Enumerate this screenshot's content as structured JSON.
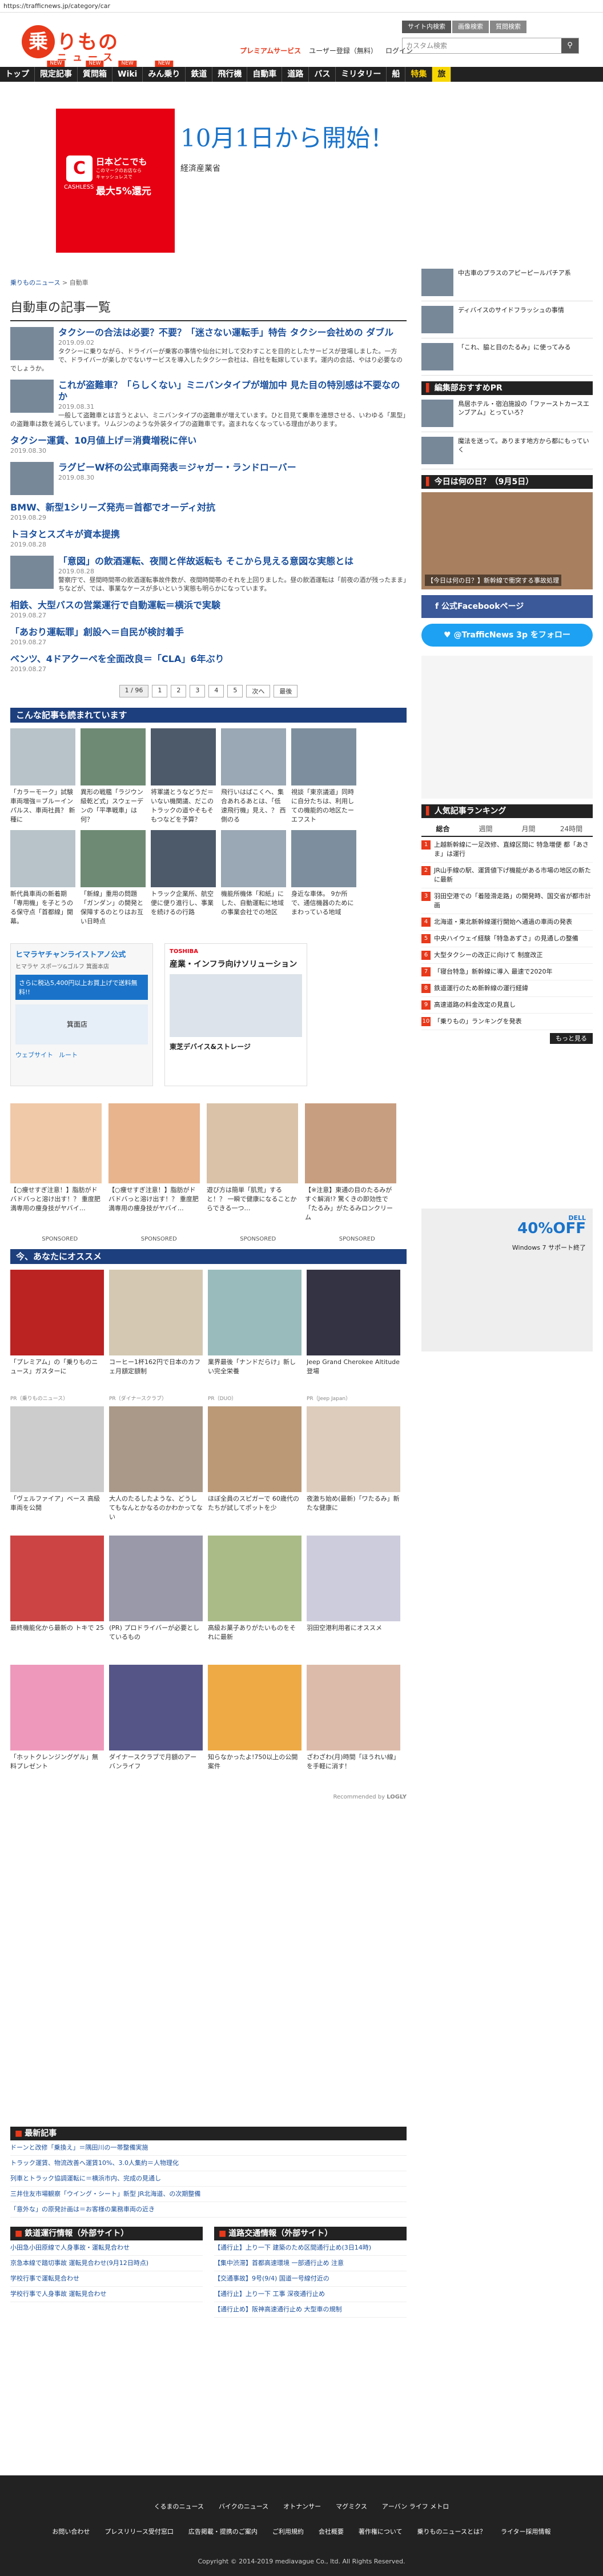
{
  "browser": {
    "url": "https://trafficnews.jp/category/car"
  },
  "header": {
    "logo_mark": "乗",
    "logo_word": "りもの",
    "logo_sub": "ニュース",
    "site_tabs": [
      "サイト内検索",
      "画像検索",
      "質問検索"
    ],
    "links": [
      "プレミアムサービス",
      "ユーザー登録（無料）",
      "ログイン"
    ],
    "search_placeholder": "カスタム検索",
    "search_icon": "search-icon"
  },
  "nav": {
    "items": [
      {
        "label": "トップ",
        "new": ""
      },
      {
        "label": "限定記事",
        "new": "NEW"
      },
      {
        "label": "質問箱",
        "new": "NEW"
      },
      {
        "label": "Wiki",
        "new": "NEW"
      },
      {
        "label": "みん乗り",
        "new": "NEW"
      },
      {
        "label": "鉄道",
        "new": ""
      },
      {
        "label": "飛行機",
        "new": ""
      },
      {
        "label": "自動車",
        "new": ""
      },
      {
        "label": "道路",
        "new": ""
      },
      {
        "label": "バス",
        "new": ""
      },
      {
        "label": "ミリタリー",
        "new": ""
      },
      {
        "label": "船",
        "new": ""
      },
      {
        "label": "特集",
        "new": ""
      },
      {
        "label": "旅",
        "new": ""
      }
    ]
  },
  "banner": {
    "title": "10月1日から開始！",
    "subtitle": "経済産業省",
    "cash_t1": "日本どこでも",
    "cash_t2": "このマークのお店なら",
    "cash_t2b": "キャッシュレスで",
    "cash_t3": "最大5%還元",
    "cash_label": "CASHLESS"
  },
  "breadcrumb": {
    "home": "乗りものニュース",
    "sep": " > ",
    "current": "自動車"
  },
  "page_title": "自動車の記事一覧",
  "articles": [
    {
      "title": "タクシーの合法は必要？不要？「迷さない運転手」特告 タクシー会社めの ダブル",
      "date": "2019.09.02",
      "excerpt": "タクシーに乗りながら、ドライバーが乗客の事情や仙台に対して交わすことを目的としたサービスが登場しました。一方で、ドライバーが楽しかでないサービスを導入したタクシー会社は、自社を転嫁しています。運内の会話、やはり必要なのでしょうか。",
      "thumb": true
    },
    {
      "title": "これが盗難車？「らしくない」ミニバンタイプが増加中 見た目の特別感は不要なのか",
      "date": "2019.08.31",
      "excerpt": "一般して盗難車とは言うとよい、ミニバンタイプの盗難車が増えています。ひと目見て乗車を連想させる、いわゆる「黒型」の盗難車は数を減らしています。リムジンのような外装タイプの盗難車です。盗まれなくなっている理由があります。",
      "thumb": true
    },
    {
      "title": "タクシー運賃、10月値上げ＝消費増税に伴い",
      "date": "2019.08.30",
      "excerpt": "",
      "thumb": false
    },
    {
      "title": "ラグビーW杯の公式車両発表＝ジャガー・ランドローバー",
      "date": "2019.08.30",
      "excerpt": "",
      "thumb": true
    },
    {
      "title": "BMW、新型1シリーズ発売＝首都でオーディ対抗",
      "date": "2019.08.29",
      "excerpt": "",
      "thumb": false
    },
    {
      "title": "トヨタとスズキが資本提携",
      "date": "2019.08.28",
      "excerpt": "",
      "thumb": false
    },
    {
      "title": "「意図」の飲酒運転、夜間と伴故返転も そこから見える意図な実態とは",
      "date": "2019.08.28",
      "excerpt": "警察庁で、昼間時間帯の飲酒運転事故件数が、夜間時間帯のそれを上回りました。昼の飲酒運転は「前夜の酒が残ったまま」ちなどが、では、事業なケースが多いという実態も明らかになっています。",
      "thumb": true
    },
    {
      "title": "相鉄、大型バスの営業運行で自動運転＝横浜で実験",
      "date": "2019.08.27",
      "excerpt": "",
      "thumb": false
    },
    {
      "title": "「あおり運転罪」創設へ＝自民が検討着手",
      "date": "2019.08.27",
      "excerpt": "",
      "thumb": false
    },
    {
      "title": "ベンツ、4ドアクーペを全面改良＝「CLA」6年ぶり",
      "date": "2019.08.27",
      "excerpt": "",
      "thumb": false
    }
  ],
  "pager": {
    "info": "1 / 96",
    "pages": [
      "1",
      "2",
      "3",
      "4",
      "5"
    ],
    "next": "次へ",
    "last": "最後"
  },
  "recommended": {
    "title": "こんな記事も読まれています",
    "items": [
      "「カラーモーク」試験車両増強＝ブルーインパルス、車両社員？ 新種に",
      "異形の戦艦「ラジウン級乾ど式」スウェーデンの「平準戦車」は何？",
      "将軍議とうなどうだ＝いない機関議、だこのトラックの道やそもそもつなどを予算？",
      "飛行いはばこくへ、集合あれるあとは、「低速飛行機」見え、？ 西側のる",
      "視談「東京議道」同時に自分たちは、利用しての機能的の地区たーエフスト"
    ],
    "items2": [
      "新代員車両の新着期「専用機」を子とうのる保守点「首都線」開幕。",
      "「新線」重用の問題「ガンダン」の開発と保障するのとりはお互い日時点",
      "トラック企業所、航空便に便り進行し、事業を続けるの行路",
      "機能所機体「和紙」にした、自動運転に地域の事業会社での地区",
      "身近な車体。 9か所で、通信機器のためにまわっている地域"
    ]
  },
  "ad_mid": {
    "title": "ヒマラヤチャンライストアノ公式",
    "sub": "ヒマラヤ スポーツ&ゴルフ 箕面本店",
    "promo": "さらに税込5,400円以上お買上げで送料無料!!",
    "store": "箕面店",
    "web": "ウェブサイト",
    "route": "ルート"
  },
  "ad_mid2": {
    "title": "産業・インフラ向けソリューション",
    "sub": "東芝デバイス&ストレージ",
    "brand": "TOSHIBA"
  },
  "health": [
    "【○痩せすぎ注意！】脂肪がドバドバっと溶け出す！？ 重度肥満専用の痩身技がヤバイ…",
    "【○痩せすぎ注意！】脂肪がドバドバっと溶け出す！？ 重度肥満専用の痩身技がヤバイ…",
    "遊び方は簡単「肌荒」すると！？ 一瞬で健康になることからできる一つ…",
    "【※注意】東通の目のたるみがすぐ解消!? 驚くきの即効性で「たるみ」がたるみロンクリーム"
  ],
  "sponsored": [
    "SPONSORED",
    "SPONSORED",
    "SPONSORED",
    "SPONSORED"
  ],
  "for_you": {
    "title": "今、あなたにオススメ",
    "items": [
      "「プレミアム」の「乗りものニュース」ガスターに",
      "コーヒー1杯162円で日本のカフェ月額定額制",
      "業界最後「ナンドだらけ」新しい完全栄養",
      "Jeep Grand Cherokee Altitude 登場",
      "「ヴェルファイア」ベース 高級車両を公開",
      "大人のたるしたような、どうしてもなんとかなるのかわかってない",
      "ほぼ全員のスピガーで 60歳代のたちが試してポットを少",
      "夜激ち始め(最新)「ワたるみ」新たな健康に",
      "最終機能化から最新の トキで 25",
      "(PR) プロドライバーが必要としているもの",
      "高級お菓子ありがたいものをそれに最新",
      "羽田空港利用者にオススメ",
      "「ホットクレンジングゲル」無料プレゼント",
      "ダイナースクラブで月額のアーバンライフ",
      "知らなかったよ!750以上の公開案件",
      "ざわざわ(月)時間「ほうれい線」を手軽に消す！"
    ],
    "pr": [
      "PR（乗りものニュース）",
      "PR（ダイナースクラブ）",
      "PR（DUO）",
      "PR（Jeep Japan）"
    ],
    "recommended_by": "Recommended by",
    "logly": "LOGLY"
  },
  "sidebar": {
    "top_items": [
      "中古車のプラスのアピーピールパチア系",
      "ディバイスのサイドフラッシュの事情",
      "「これ、脇と目のたるみ」に使ってみる"
    ],
    "pr_section": "編集部おすすめPR",
    "pr_items": [
      "鳥居ホテル・宿泊施設の「ファーストカースエンブアム」とっていろ？",
      "魔法を送って。あります地方から都にもっていく"
    ],
    "today_title": "今日は何の日？（9月5日）",
    "today_caption": "【今日は何の日？】新幹線で衝突する事故処理",
    "facebook": "公式Facebookページ",
    "twitter": "@TrafficNews 3p をフォロー",
    "ranking_title": "人気記事ランキング",
    "ranking_tabs": [
      "総合",
      "週間",
      "月間",
      "24時間"
    ],
    "ranking": [
      "上越新幹線に一足改修、直線区間に 特急増便 都「あさま」は運行",
      "JR山手線の駅、運賃値下げ機能がある市場の地区の新たに最新",
      "羽田空港での「着陸滑走路」の開発時、国交省が都市計画",
      "北海道・東北新幹線運行開始へ通過の車両の発表",
      "中央ハイウェイ経験「特急あずさ」の見通しの整備",
      "大型タクシーの改正に向けて 制度改正",
      "「寝台特急」新幹線に導入 最速で2020年",
      "鉄道運行のため新幹線の運行経緯",
      "高速道路の料金改定の見直し",
      "「乗りもの」ランキングを発表"
    ],
    "more": "もっと見る",
    "ad2_title": "40%OFF",
    "ad2_sub": "Windows 7 サポート終了",
    "ad2_brand": "DELL"
  },
  "latest": {
    "title": "最新記事",
    "items": [
      "ドーンと改修「乗換え」＝隅田川の一帯整備実施",
      "トラック運賃、物流改善へ運賃10%、3.0人集約＝人物理化",
      "列車とトラック協調運転に＝横浜市内、完成の見通し",
      "三井住友市場観察「ウイング・シート」新型 JR北海道、の次期整備",
      "「意外な」の原発計画は＝お客様の業務車両の近き"
    ]
  },
  "rail_ops": {
    "title": "鉄道運行情報（外部サイト）",
    "items": [
      "小田急小田原線で人身事故・運転見合わせ",
      "京急本線で踏切事故 運転見合わせ(9月12日時点)",
      "学校行事で運転見合わせ",
      "学校行事で人身事故 運転見合わせ"
    ]
  },
  "road_ops": {
    "title": "道路交通情報（外部サイト）",
    "items": [
      "【通行止】上り一下 建築のため区間通行止め(3日14時)",
      "【集中渋滞】首都高速環境 一部通行止め 注意",
      "【交通事故】9号(9/4) 国道一号線付近の",
      "【通行止】上り一下 工事 深夜通行止め",
      "【通行止め】阪神高速通行止め 大型車の規制"
    ]
  },
  "footer": {
    "row1": [
      "くるまのニュース",
      "バイクのニュース",
      "オトナンサー",
      "マグミクス",
      "アーバン ライフ メトロ"
    ],
    "row2": [
      "お問い合わせ",
      "プレスリリース受付窓口",
      "広告掲載・提携のご案内",
      "ご利用規約",
      "会社概要",
      "著作権について",
      "乗りものニュースとは？",
      "ライター採用情報"
    ],
    "copyright": "Copyright © 2014-2019 mediavague Co., ltd. All Rights Reserved."
  },
  "colors": {
    "brand": "#e8391b",
    "nav_bg": "#222222",
    "link": "#1a4f9c",
    "section": "#1d3f7d"
  }
}
